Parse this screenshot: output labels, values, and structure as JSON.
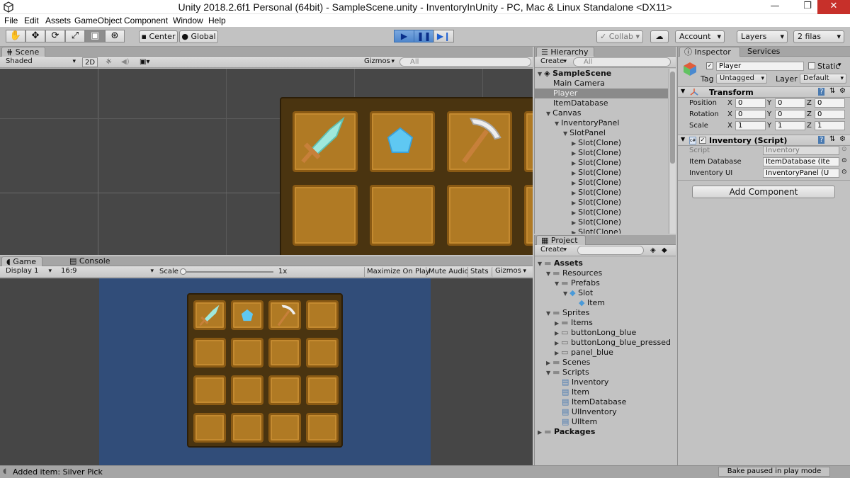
{
  "window": {
    "title": "Unity 2018.2.6f1 Personal (64bit) - SampleScene.unity - InventoryInUnity - PC, Mac & Linux Standalone <DX11>",
    "minimize": "—",
    "maximize": "❐",
    "close": "✕"
  },
  "menu": [
    "File",
    "Edit",
    "Assets",
    "GameObject",
    "Component",
    "Window",
    "Help"
  ],
  "toolbar": {
    "center": "Center",
    "global": "Global",
    "collab": "Collab",
    "account": "Account",
    "layers": "Layers",
    "layout": "2 filas"
  },
  "scene": {
    "tab": "Scene",
    "shading": "Shaded",
    "mode2d": "2D",
    "gizmos": "Gizmos",
    "search": "All"
  },
  "game": {
    "tab": "Game",
    "console_tab": "Console",
    "display": "Display 1",
    "aspect": "16:9",
    "scale_label": "Scale",
    "scale_value": "1x",
    "maximize": "Maximize On Play",
    "mute": "Mute Audio",
    "stats": "Stats",
    "gizmos": "Gizmos"
  },
  "hierarchy": {
    "tab": "Hierarchy",
    "create": "Create",
    "search": "All",
    "items": [
      {
        "label": "SampleScene",
        "depth": 0,
        "expanded": true,
        "bold": true
      },
      {
        "label": "Main Camera",
        "depth": 1
      },
      {
        "label": "Player",
        "depth": 1,
        "selected": true
      },
      {
        "label": "ItemDatabase",
        "depth": 1
      },
      {
        "label": "Canvas",
        "depth": 1,
        "expanded": true
      },
      {
        "label": "InventoryPanel",
        "depth": 2,
        "expanded": true
      },
      {
        "label": "SlotPanel",
        "depth": 3,
        "expanded": true
      },
      {
        "label": "Slot(Clone)",
        "depth": 4,
        "collapsed": true
      },
      {
        "label": "Slot(Clone)",
        "depth": 4,
        "collapsed": true
      },
      {
        "label": "Slot(Clone)",
        "depth": 4,
        "collapsed": true
      },
      {
        "label": "Slot(Clone)",
        "depth": 4,
        "collapsed": true
      },
      {
        "label": "Slot(Clone)",
        "depth": 4,
        "collapsed": true
      },
      {
        "label": "Slot(Clone)",
        "depth": 4,
        "collapsed": true
      },
      {
        "label": "Slot(Clone)",
        "depth": 4,
        "collapsed": true
      },
      {
        "label": "Slot(Clone)",
        "depth": 4,
        "collapsed": true
      },
      {
        "label": "Slot(Clone)",
        "depth": 4,
        "collapsed": true
      },
      {
        "label": "Slot(Clone)",
        "depth": 4,
        "collapsed": true
      }
    ]
  },
  "project": {
    "tab": "Project",
    "create": "Create",
    "items": [
      {
        "label": "Assets",
        "depth": 0,
        "type": "folder",
        "bold": true
      },
      {
        "label": "Resources",
        "depth": 1,
        "type": "folder"
      },
      {
        "label": "Prefabs",
        "depth": 2,
        "type": "folder"
      },
      {
        "label": "Slot",
        "depth": 3,
        "type": "prefab"
      },
      {
        "label": "Item",
        "depth": 4,
        "type": "prefab"
      },
      {
        "label": "Sprites",
        "depth": 1,
        "type": "folder"
      },
      {
        "label": "Items",
        "depth": 2,
        "type": "folder",
        "collapsed": true
      },
      {
        "label": "buttonLong_blue",
        "depth": 2,
        "type": "sprite",
        "collapsed": true
      },
      {
        "label": "buttonLong_blue_pressed",
        "depth": 2,
        "type": "sprite",
        "collapsed": true
      },
      {
        "label": "panel_blue",
        "depth": 2,
        "type": "sprite",
        "collapsed": true
      },
      {
        "label": "Scenes",
        "depth": 1,
        "type": "folder",
        "collapsed": true
      },
      {
        "label": "Scripts",
        "depth": 1,
        "type": "folder"
      },
      {
        "label": "Inventory",
        "depth": 2,
        "type": "script"
      },
      {
        "label": "Item",
        "depth": 2,
        "type": "script"
      },
      {
        "label": "ItemDatabase",
        "depth": 2,
        "type": "script"
      },
      {
        "label": "UIInventory",
        "depth": 2,
        "type": "script"
      },
      {
        "label": "UIItem",
        "depth": 2,
        "type": "script"
      },
      {
        "label": "Packages",
        "depth": 0,
        "type": "folder",
        "bold": true,
        "collapsed": true
      }
    ]
  },
  "inspector": {
    "tab": "Inspector",
    "services_tab": "Services",
    "name": "Player",
    "static_label": "Static",
    "tag_label": "Tag",
    "tag": "Untagged",
    "layer_label": "Layer",
    "layer": "Default",
    "transform": {
      "title": "Transform",
      "rows": [
        {
          "label": "Position",
          "x": "0",
          "y": "0",
          "z": "0"
        },
        {
          "label": "Rotation",
          "x": "0",
          "y": "0",
          "z": "0"
        },
        {
          "label": "Scale",
          "x": "1",
          "y": "1",
          "z": "1"
        }
      ]
    },
    "script": {
      "title": "Inventory (Script)",
      "script_label": "Script",
      "script_value": "Inventory",
      "db_label": "Item Database",
      "db_value": "ItemDatabase (Ite",
      "ui_label": "Inventory UI",
      "ui_value": "InventoryPanel (U"
    },
    "add_component": "Add Component"
  },
  "axes": {
    "x": "X",
    "y": "Y",
    "z": "Z"
  },
  "status": {
    "message": "Added item: Silver Pick",
    "bake": "Bake paused in play mode"
  },
  "colors": {
    "scene_bg": "#474747",
    "game_bg": "#314d79",
    "play_blue": "#4f86cc",
    "slot": "#b07a24",
    "panel_dark": "#4a3410"
  }
}
